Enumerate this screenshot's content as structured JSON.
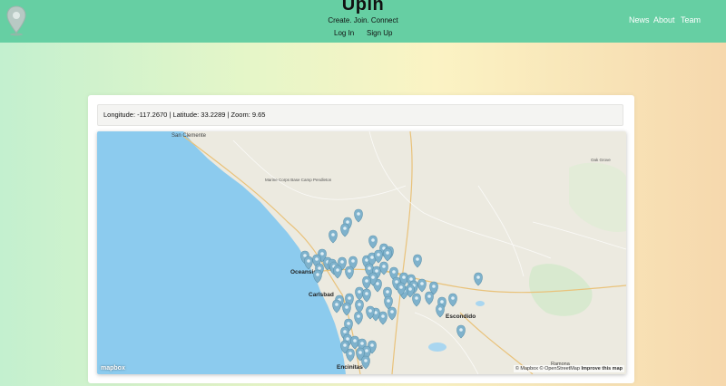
{
  "header": {
    "title": "Upin",
    "tagline": "Create. Join. Connect",
    "login_label": "Log In",
    "signup_label": "Sign Up",
    "nav": [
      "News",
      "About",
      "Team"
    ],
    "logo_icon": "map-pin-icon"
  },
  "coords": {
    "text": "Longitude: -117.2670 | Latitude: 33.2289 | Zoom: 9.65"
  },
  "map": {
    "places": [
      "San Clemente",
      "Marine Corps Base Camp Pendleton",
      "Oceanside",
      "Carlsbad",
      "Escondido",
      "Encinitas",
      "Ramona",
      "Oak Grove"
    ],
    "logo_text": "mapbox",
    "attribution": "© Mapbox © OpenStreetMap",
    "improve_link": "Improve this map",
    "colors": {
      "water": "#8ccbee",
      "land": "#eceae0",
      "marker": "#7fb2cc"
    }
  }
}
